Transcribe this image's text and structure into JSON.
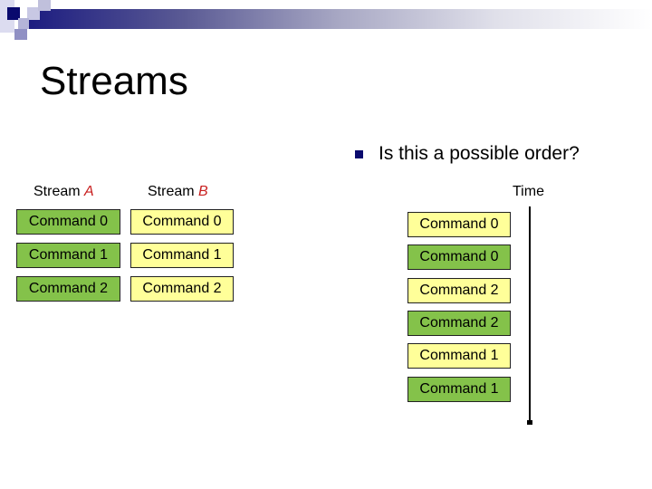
{
  "slide": {
    "title": "Streams",
    "bullet": "Is this a possible order?",
    "colors": {
      "stream_a_fill": "#84c24a",
      "stream_b_fill": "#ffff99",
      "stream_letter": "#c81e1e",
      "banner_dark": "#1c1c80",
      "bullet": "#0a0a6e"
    }
  },
  "streams": [
    {
      "prefix": "Stream ",
      "letter": "A",
      "color": "green",
      "commands": [
        "Command 0",
        "Command 1",
        "Command 2"
      ]
    },
    {
      "prefix": "Stream ",
      "letter": "B",
      "color": "yellow",
      "commands": [
        "Command 0",
        "Command 1",
        "Command 2"
      ]
    }
  ],
  "timeline": {
    "label": "Time",
    "order": [
      {
        "label": "Command 0",
        "stream": "B"
      },
      {
        "label": "Command 0",
        "stream": "A"
      },
      {
        "label": "Command 2",
        "stream": "B"
      },
      {
        "label": "Command 2",
        "stream": "A"
      },
      {
        "label": "Command 1",
        "stream": "B"
      },
      {
        "label": "Command 1",
        "stream": "A"
      }
    ]
  }
}
